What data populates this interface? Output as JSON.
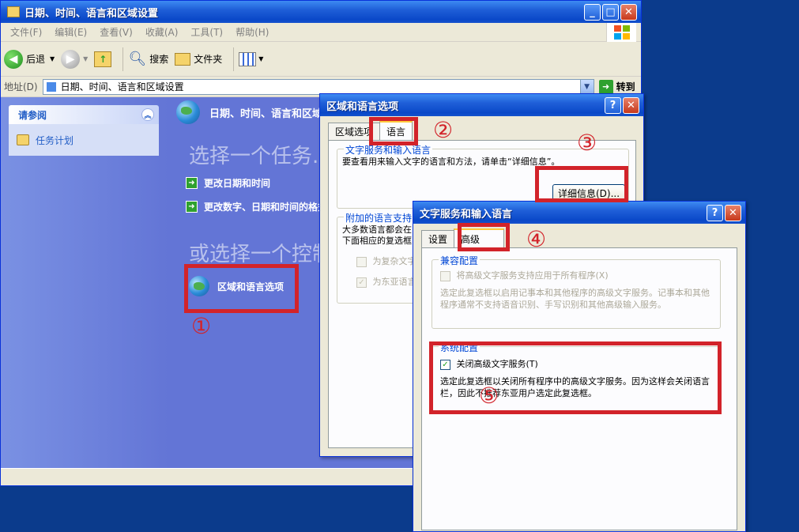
{
  "explorer": {
    "title": "日期、时间、语言和区域设置",
    "menu": [
      "文件(F)",
      "编辑(E)",
      "查看(V)",
      "收藏(A)",
      "工具(T)",
      "帮助(H)"
    ],
    "toolbar": {
      "back": "后退",
      "search": "搜索",
      "folders": "文件夹"
    },
    "address": {
      "label": "地址(D)",
      "value": "日期、时间、语言和区域设置",
      "go": "转到"
    },
    "see_also": {
      "header": "请参阅",
      "items": [
        "任务计划"
      ]
    },
    "category_title": "日期、时间、语言和区域设置",
    "pick_task": "选择一个任务...",
    "tasks": [
      "更改日期和时间",
      "更改数字、日期和时间的格式"
    ],
    "pick_icon": "或选择一个控制面板图标",
    "icons": [
      "区域和语言选项"
    ]
  },
  "region_dialog": {
    "title": "区域和语言选项",
    "tabs": [
      "区域选项",
      "语言"
    ],
    "group1": {
      "title": "文字服务和输入语言",
      "text": "要查看用来输入文字的语言和方法，请单击“详细信息”。",
      "button": "详细信息(D)..."
    },
    "group2": {
      "title": "附加的语言支持",
      "text_line1": "大多数语言都会在",
      "text_line2": "下面相应的复选框",
      "check1": "为复杂文字",
      "check2": "为东亚语言"
    }
  },
  "text_services_dialog": {
    "title": "文字服务和输入语言",
    "tabs": [
      "设置",
      "高级"
    ],
    "compat": {
      "title": "兼容配置",
      "checkbox": "将高级文字服务支持应用于所有程序(X)",
      "text": "选定此复选框以启用记事本和其他程序的高级文字服务。记事本和其他程序通常不支持语音识别、手写识别和其他高级输入服务。"
    },
    "system": {
      "title": "系统配置",
      "checkbox": "关闭高级文字服务(T)",
      "text": "选定此复选框以关闭所有程序中的高级文字服务。因为这样会关闭语言栏，因此不推荐东亚用户选定此复选框。"
    }
  },
  "annotations": [
    "①",
    "②",
    "③",
    "④",
    "⑤"
  ],
  "colors": {
    "annotation": "#d2232a",
    "xp_blue": "#0a48c8",
    "panel_blue": "#6375d6"
  }
}
